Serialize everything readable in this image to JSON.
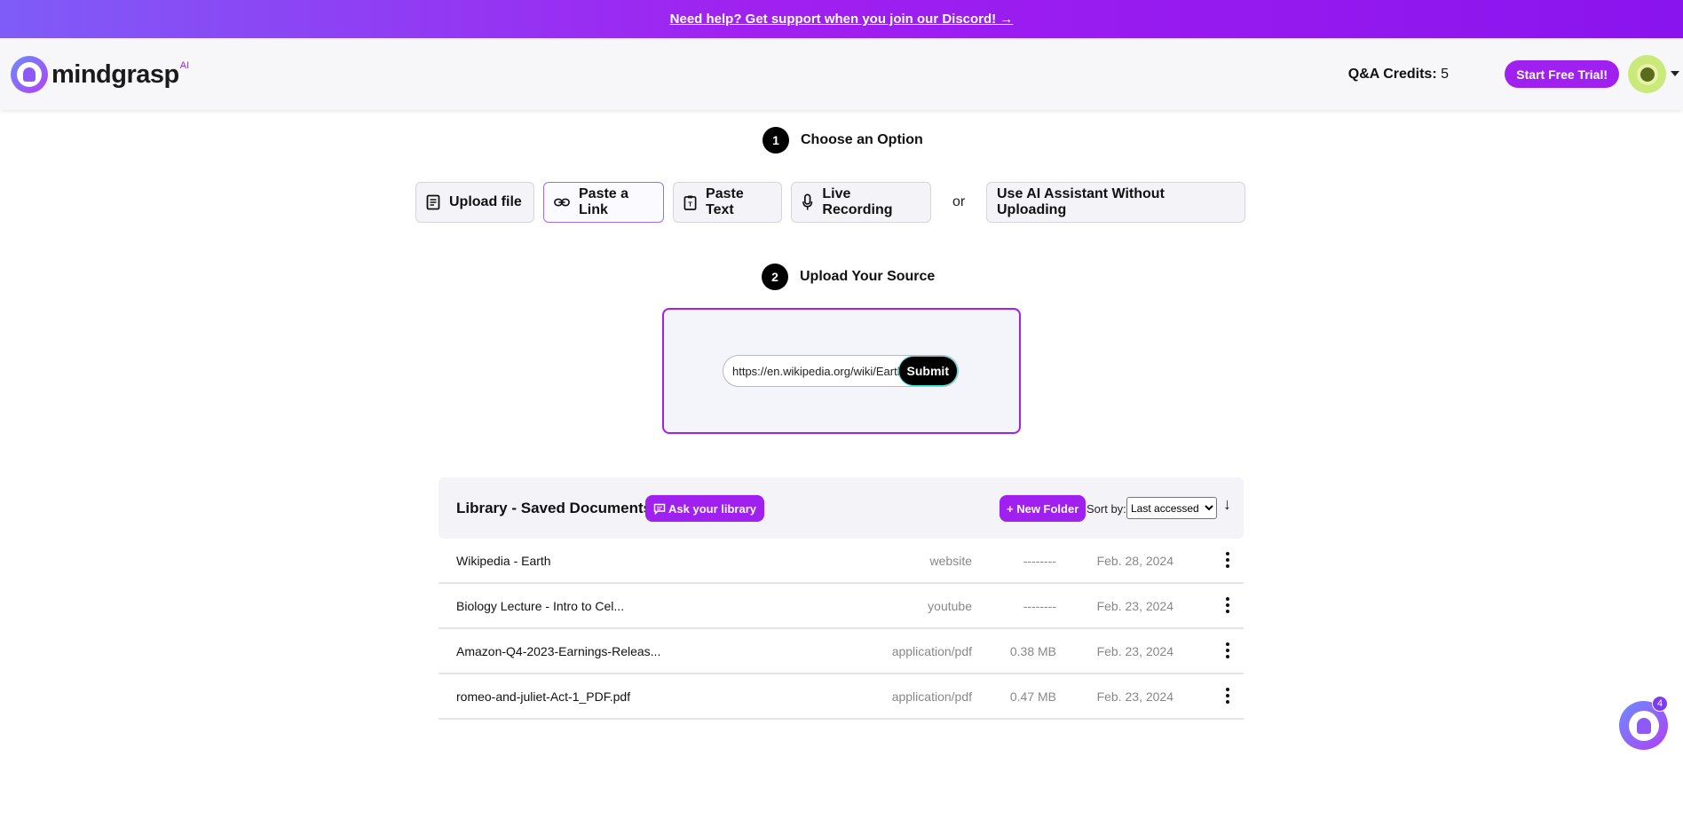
{
  "banner": {
    "text": "Need help? Get support when you join our Discord! →"
  },
  "header": {
    "logo_text": "mindgrasp",
    "logo_sup": "AI",
    "credits_label": "Q&A Credits:",
    "credits_value": "5",
    "trial_button": "Start Free Trial!"
  },
  "step1": {
    "number": "1",
    "label": "Choose an Option"
  },
  "options": {
    "upload_file": "Upload file",
    "paste_link": "Paste a Link",
    "paste_text": "Paste Text",
    "live_recording": "Live Recording",
    "or": "or",
    "ai_assistant": "Use AI Assistant Without Uploading",
    "selected": "Paste a Link"
  },
  "step2": {
    "number": "2",
    "label": "Upload Your Source"
  },
  "link_input": {
    "value": "https://en.wikipedia.org/wiki/Earth",
    "submit": "Submit"
  },
  "library": {
    "title": "Library - Saved Documents",
    "ask_button": "Ask your library",
    "new_folder_button": "+ New Folder",
    "sort_label": "Sort by:",
    "sort_value": "Last accessed",
    "sort_direction": "↓",
    "rows": [
      {
        "name": "Wikipedia - Earth",
        "type": "website",
        "size": "--------",
        "date": "Feb. 28, 2024"
      },
      {
        "name": "Biology Lecture - Intro to Cel...",
        "type": "youtube",
        "size": "--------",
        "date": "Feb. 23, 2024"
      },
      {
        "name": "Amazon-Q4-2023-Earnings-Releas...",
        "type": "application/pdf",
        "size": "0.38 MB",
        "date": "Feb. 23, 2024"
      },
      {
        "name": "romeo-and-juliet-Act-1_PDF.pdf",
        "type": "application/pdf",
        "size": "0.47 MB",
        "date": "Feb. 23, 2024"
      }
    ]
  },
  "chat": {
    "badge": "4"
  },
  "colors": {
    "accent": "#a020f0",
    "banner_start": "#7f5cf7",
    "banner_end": "#8a14ee"
  }
}
